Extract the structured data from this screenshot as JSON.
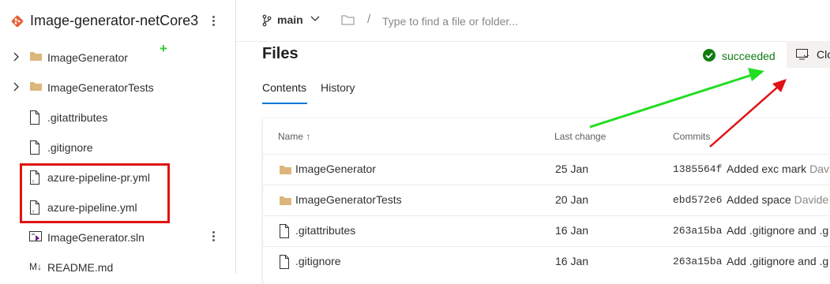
{
  "sidebar": {
    "repo_name": "Image-generator-netCore3",
    "items": [
      {
        "label": "ImageGenerator",
        "type": "folder"
      },
      {
        "label": "ImageGeneratorTests",
        "type": "folder"
      },
      {
        "label": ".gitattributes",
        "type": "file"
      },
      {
        "label": ".gitignore",
        "type": "file"
      },
      {
        "label": "azure-pipeline-pr.yml",
        "type": "yml"
      },
      {
        "label": "azure-pipeline.yml",
        "type": "yml"
      },
      {
        "label": "ImageGenerator.sln",
        "type": "sln"
      },
      {
        "label": "README.md",
        "type": "md"
      }
    ],
    "plus_annotation": "+"
  },
  "topbar": {
    "branch": "main",
    "path_separator": "/",
    "path_placeholder": "Type to find a file or folder..."
  },
  "main": {
    "title": "Files",
    "status": "succeeded",
    "clone_label": "Clone",
    "tabs": [
      {
        "label": "Contents",
        "active": true
      },
      {
        "label": "History",
        "active": false
      }
    ],
    "table": {
      "headers": {
        "name": "Name ↑",
        "last_change": "Last change",
        "commits": "Commits"
      },
      "rows": [
        {
          "name": "ImageGenerator",
          "type": "folder",
          "last_change": "25 Jan",
          "commit": "1385564f",
          "message": "Added exc mark",
          "author": "Davide"
        },
        {
          "name": "ImageGeneratorTests",
          "type": "folder",
          "last_change": "20 Jan",
          "commit": "ebd572e6",
          "message": "Added space",
          "author": "Davide"
        },
        {
          "name": ".gitattributes",
          "type": "file",
          "last_change": "16 Jan",
          "commit": "263a15ba",
          "message": "Add .gitignore and .g",
          "author": ""
        },
        {
          "name": ".gitignore",
          "type": "file",
          "last_change": "16 Jan",
          "commit": "263a15ba",
          "message": "Add .gitignore and .g",
          "author": ""
        }
      ]
    }
  },
  "colors": {
    "accent": "#0078d4",
    "success": "#107c10",
    "annotation_green": "#22dd22",
    "annotation_red": "#e01212",
    "folder": "#dcb67a",
    "repo_icon": "#e8623a"
  }
}
